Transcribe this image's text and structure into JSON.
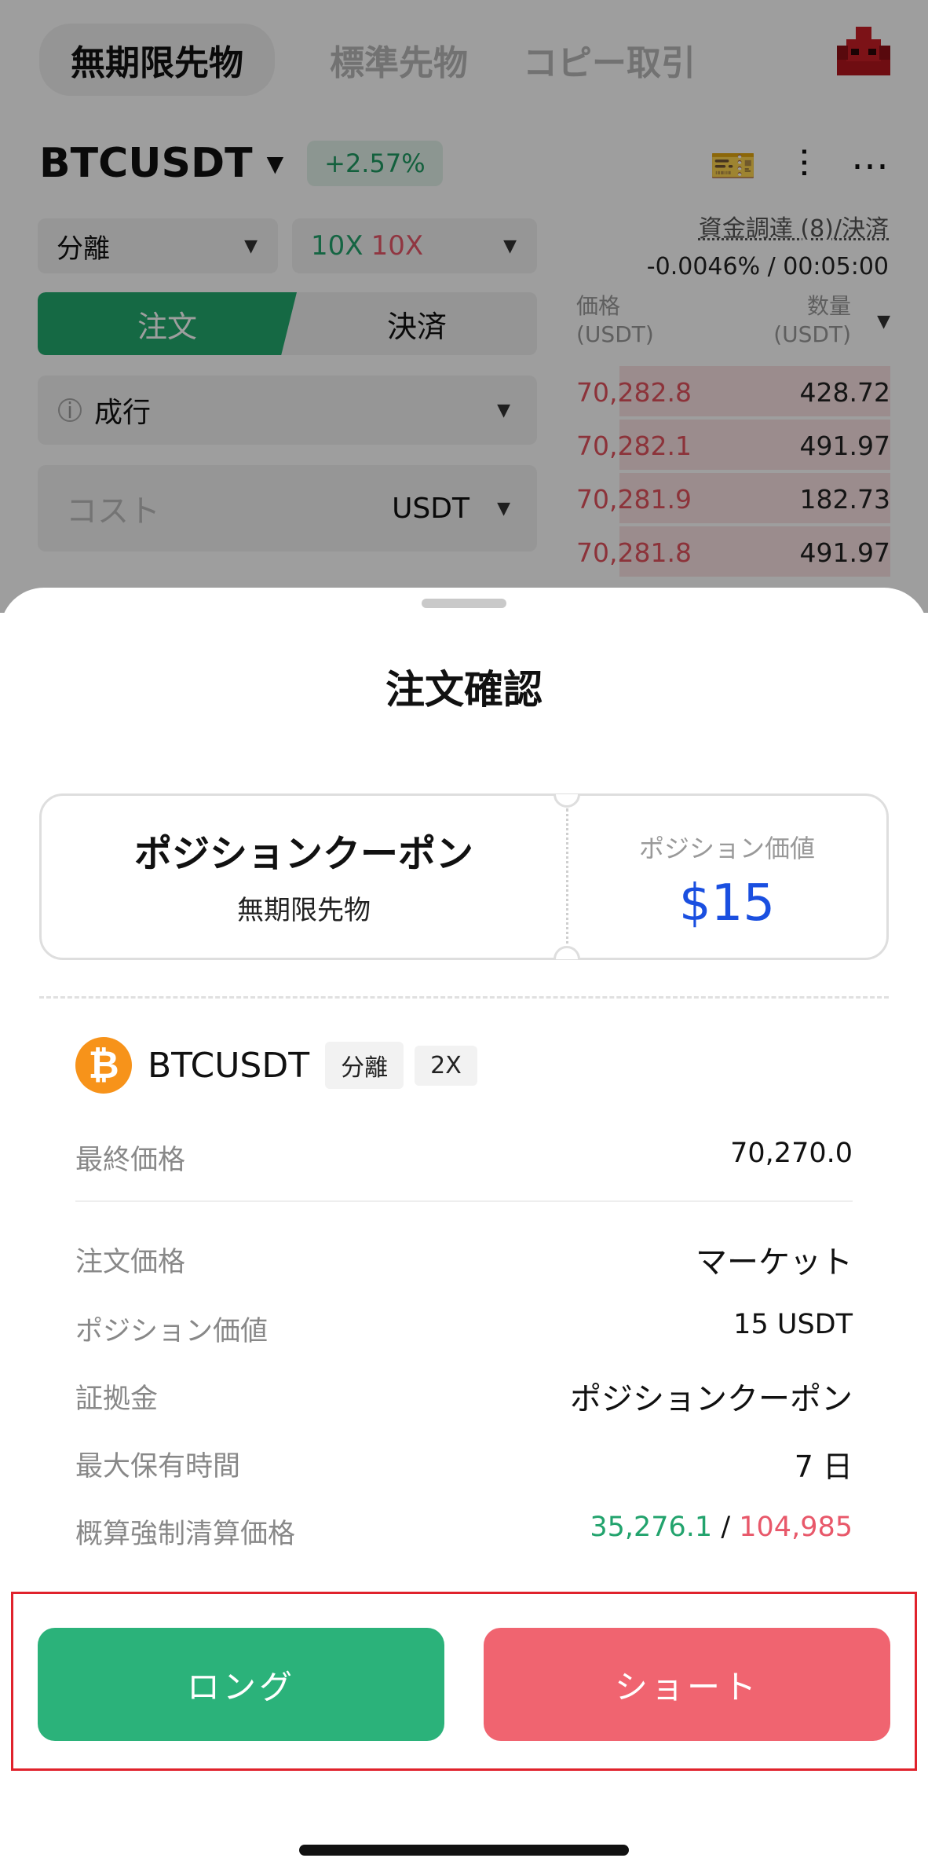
{
  "top_tabs": [
    "無期限先物",
    "標準先物",
    "コピー取引"
  ],
  "pair": {
    "name": "BTCUSDT",
    "change": "+2.57%"
  },
  "margin_mode": "分離",
  "leverage": {
    "long": "10X",
    "short": "10X"
  },
  "funding": {
    "label": "資金調達 (8)/決済",
    "value": "-0.0046% / 00:05:00"
  },
  "order_tabs": {
    "order": "注文",
    "close": "決済"
  },
  "orderbook": {
    "price_header": "価格\n(USDT)",
    "qty_header": "数量\n(USDT)",
    "rows": [
      {
        "price": "70,282.8",
        "qty": "428.72"
      },
      {
        "price": "70,282.1",
        "qty": "491.97"
      },
      {
        "price": "70,281.9",
        "qty": "182.73"
      },
      {
        "price": "70,281.8",
        "qty": "491.97"
      }
    ]
  },
  "order_type": "成行",
  "cost_input": {
    "placeholder": "コスト",
    "unit": "USDT"
  },
  "sheet": {
    "title": "注文確認",
    "coupon": {
      "title": "ポジションクーポン",
      "subtitle": "無期限先物",
      "value_label": "ポジション価値",
      "value": "$15"
    },
    "asset": {
      "symbol": "BTCUSDT",
      "mode_tag": "分離",
      "leverage_tag": "2X"
    },
    "last_price": {
      "label": "最終価格",
      "value": "70,270.0"
    },
    "details": [
      {
        "label": "注文価格",
        "value": "マーケット"
      },
      {
        "label": "ポジション価値",
        "value": "15 USDT"
      },
      {
        "label": "証拠金",
        "value": "ポジションクーポン"
      },
      {
        "label": "最大保有時間",
        "value": "7 日"
      }
    ],
    "liquidation": {
      "label": "概算強制清算価格",
      "long": "35,276.1",
      "separator": "/",
      "short": "104,985"
    },
    "long_button": "ロング",
    "short_button": "ショート"
  }
}
